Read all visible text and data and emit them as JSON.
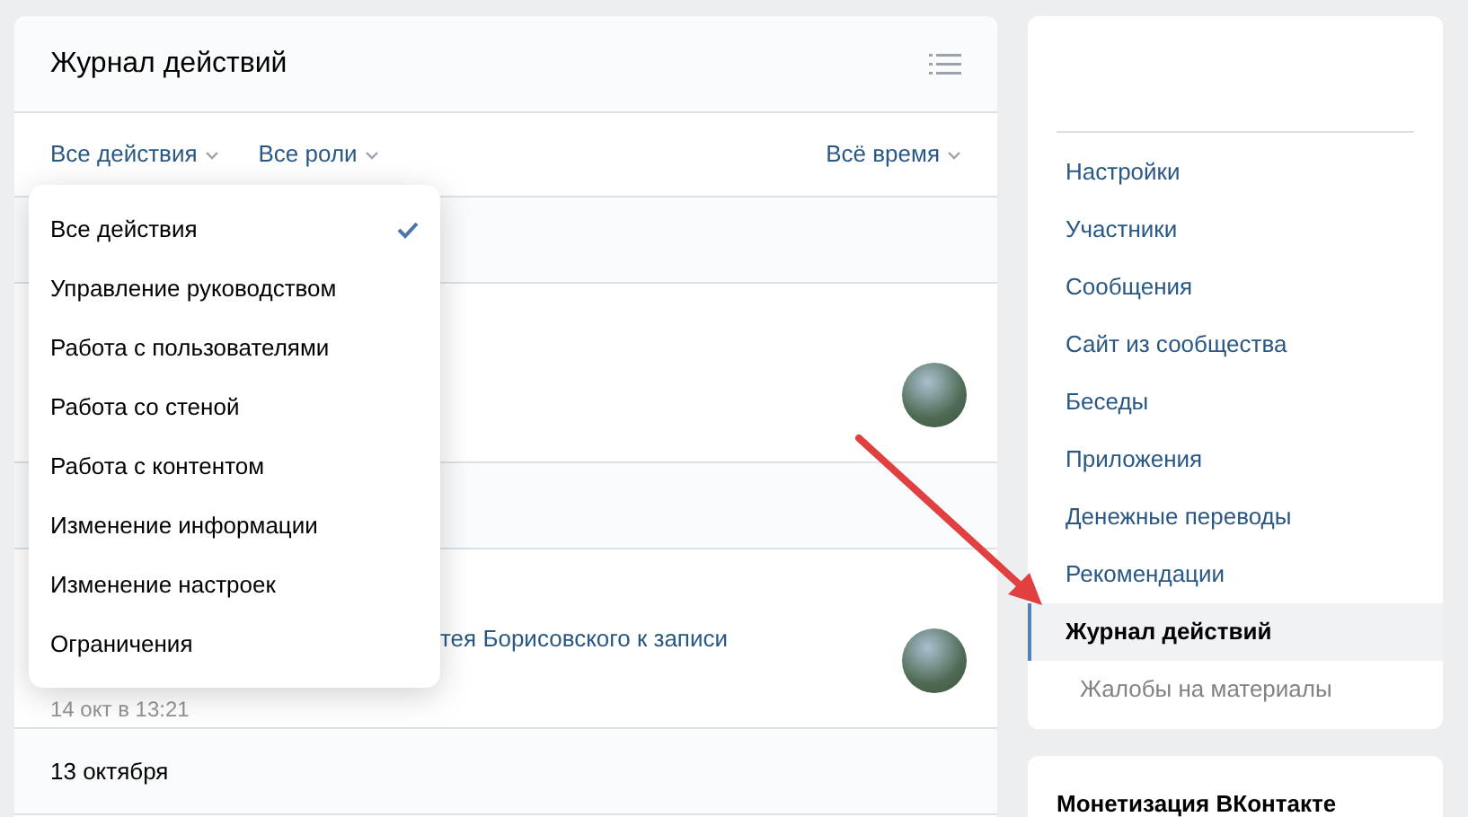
{
  "panel": {
    "title": "Журнал действий",
    "filters": [
      "Все действия",
      "Все роли"
    ],
    "period_filter": "Всё время"
  },
  "log": [
    {
      "kind": "date"
    },
    {
      "kind": "entry"
    },
    {
      "kind": "date"
    },
    {
      "kind": "entry",
      "text": "тея Борисовского к записи",
      "time": "14 окт в 13:21"
    },
    {
      "kind": "date",
      "label": "13 октября"
    }
  ],
  "dropdown": {
    "items": [
      {
        "label": "Все действия",
        "selected": true
      },
      {
        "label": "Управление руководством",
        "selected": false
      },
      {
        "label": "Работа с пользователями",
        "selected": false
      },
      {
        "label": "Работа со стеной",
        "selected": false
      },
      {
        "label": "Работа с контентом",
        "selected": false
      },
      {
        "label": "Изменение информации",
        "selected": false
      },
      {
        "label": "Изменение настроек",
        "selected": false
      },
      {
        "label": "Ограничения",
        "selected": false
      }
    ]
  },
  "sidebar": {
    "items": [
      {
        "label": "Настройки",
        "selected": false
      },
      {
        "label": "Участники",
        "selected": false
      },
      {
        "label": "Сообщения",
        "selected": false
      },
      {
        "label": "Сайт из сообщества",
        "selected": false
      },
      {
        "label": "Беседы",
        "selected": false
      },
      {
        "label": "Приложения",
        "selected": false
      },
      {
        "label": "Денежные переводы",
        "selected": false
      },
      {
        "label": "Рекомендации",
        "selected": false
      },
      {
        "label": "Журнал действий",
        "selected": true,
        "children": [
          {
            "label": "Жалобы на материалы",
            "selected": false
          }
        ]
      }
    ]
  },
  "monetization_card": {
    "title": "Монетизация ВКонтакте"
  }
}
